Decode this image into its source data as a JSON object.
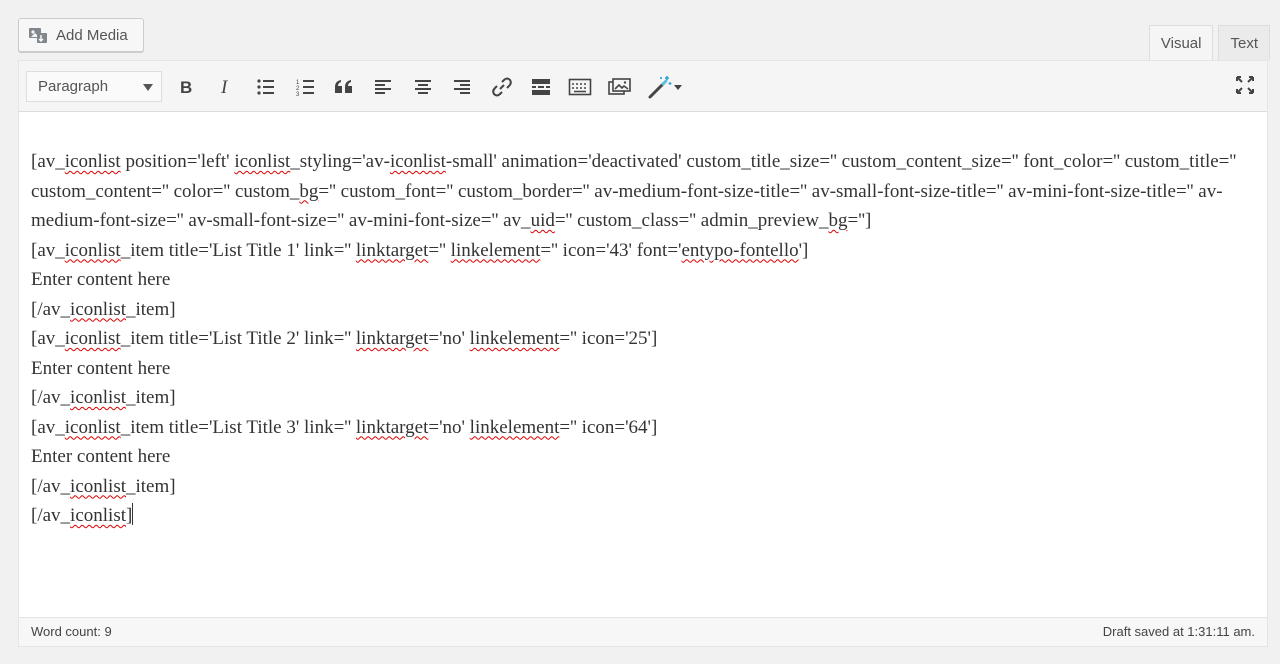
{
  "add_media": {
    "label": "Add Media",
    "icon": "add-media-icon"
  },
  "tabs": [
    {
      "label": "Visual",
      "active": true
    },
    {
      "label": "Text",
      "active": false
    }
  ],
  "toolbar": {
    "format": "Paragraph",
    "buttons": [
      "bold-icon",
      "italic-icon",
      "bulleted-list-icon",
      "numbered-list-icon",
      "blockquote-icon",
      "align-left-icon",
      "align-center-icon",
      "align-right-icon",
      "link-icon",
      "read-more-icon",
      "toolbar-toggle-icon",
      "media-icon",
      "magic-wand-icon",
      "fullscreen-icon"
    ]
  },
  "content": {
    "lines": [
      [
        "[av_",
        {
          "s": "iconlist"
        },
        " position='left' ",
        {
          "s": "iconlist"
        },
        "_styling='av-",
        {
          "s": "iconlist"
        },
        "-small' animation='deactivated' custom_title_size='' custom_content_size='' font_color='' custom_title='' custom_content='' color='' custom_",
        {
          "s": "bg"
        },
        "='' custom_font='' custom_border='' av-medium-font-size-title='' av-small-font-size-title='' av-mini-font-size-title='' av-medium-font-size='' av-small-font-size='' av-mini-font-size='' av_",
        {
          "s": "uid"
        },
        "='' custom_class='' admin_preview_",
        {
          "s": "bg"
        },
        "='']"
      ],
      [
        "[av_",
        {
          "s": "iconlist"
        },
        "_item title='List Title 1' link='' ",
        {
          "s": "linktarget"
        },
        "='' ",
        {
          "s": "linkelement"
        },
        "='' icon='43' font='",
        {
          "s": "entypo-fontello"
        },
        "']"
      ],
      [
        "Enter content here"
      ],
      [
        "[/av_",
        {
          "s": "iconlist"
        },
        "_item]"
      ],
      [
        "[av_",
        {
          "s": "iconlist"
        },
        "_item title='List Title 2' link='' ",
        {
          "s": "linktarget"
        },
        "='no' ",
        {
          "s": "linkelement"
        },
        "='' icon='25']"
      ],
      [
        "Enter content here"
      ],
      [
        "[/av_",
        {
          "s": "iconlist"
        },
        "_item]"
      ],
      [
        "[av_",
        {
          "s": "iconlist"
        },
        "_item title='List Title 3' link='' ",
        {
          "s": "linktarget"
        },
        "='no' ",
        {
          "s": "linkelement"
        },
        "='' icon='64']"
      ],
      [
        "Enter content here"
      ],
      [
        "[/av_",
        {
          "s": "iconlist"
        },
        "_item]"
      ],
      [
        "[/av_",
        {
          "s": "iconlist"
        },
        "]"
      ]
    ]
  },
  "status": {
    "word_count": "Word count: 9",
    "draft_saved": "Draft saved at 1:31:11 am."
  }
}
